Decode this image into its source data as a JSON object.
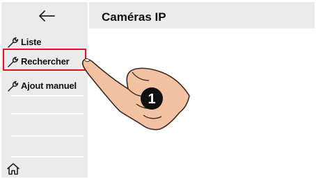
{
  "header": {
    "title": "Caméras IP"
  },
  "sidebar": {
    "back_icon": "arrow-left-icon",
    "items": [
      {
        "label": "Liste",
        "icon": "wrench-icon",
        "highlighted": false
      },
      {
        "label": "Rechercher",
        "icon": "wrench-icon",
        "highlighted": true
      },
      {
        "label": "Ajout manuel",
        "icon": "wrench-icon",
        "highlighted": false
      }
    ],
    "home_icon": "home-icon"
  },
  "annotation": {
    "step_number": "1",
    "highlight_color": "#e3131b",
    "hand_color": "#f2c2a2"
  }
}
